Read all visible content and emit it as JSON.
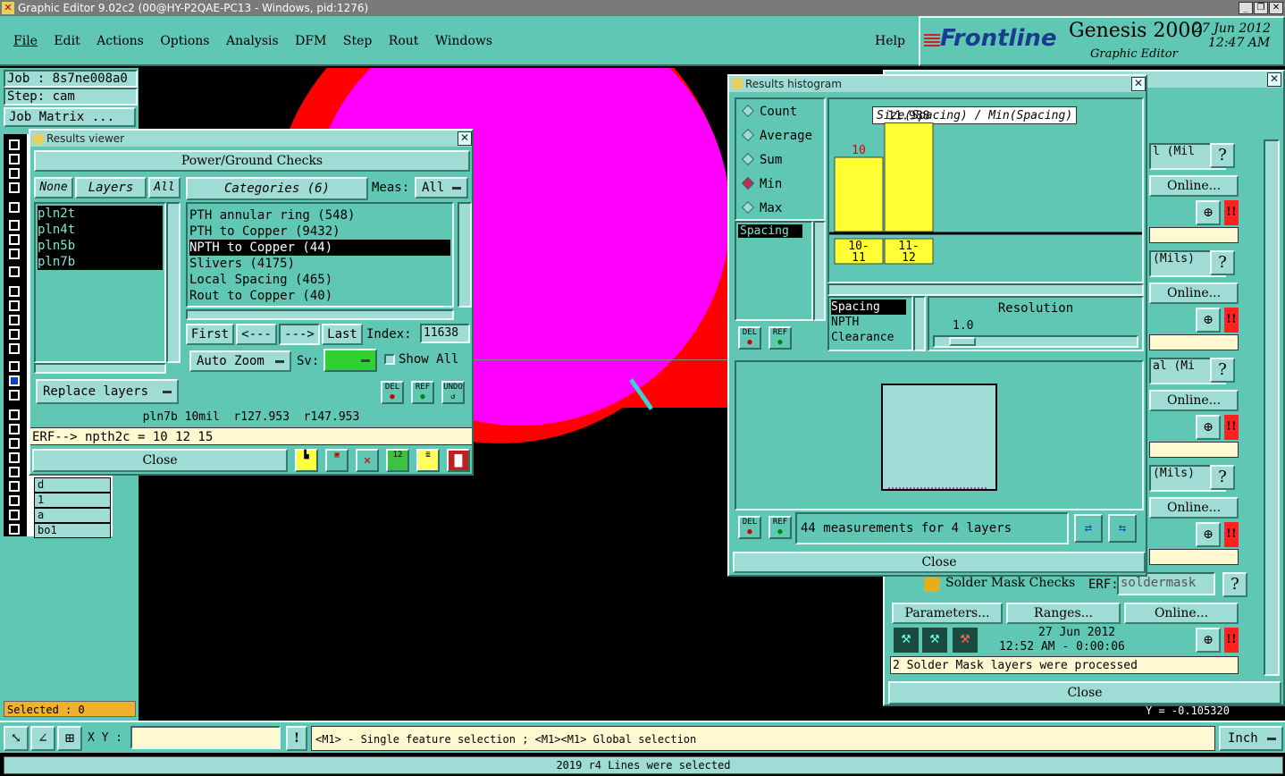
{
  "window": {
    "title": "Graphic Editor 9.02c2 (00@HY-P2QAE-PC13 - Windows, pid:1276)"
  },
  "menu": {
    "items": [
      "File",
      "Edit",
      "Actions",
      "Options",
      "Analysis",
      "DFM",
      "Step",
      "Rout",
      "Windows"
    ],
    "help": "Help"
  },
  "brand": {
    "logo": "Frontline",
    "product": "Genesis 2000",
    "date": "27 Jun 2012",
    "time": "12:47 AM",
    "subtitle": "Graphic Editor"
  },
  "left_panel": {
    "job": "Job : 8s7ne008a0",
    "step": "Step: cam",
    "job_matrix": "Job Matrix ...",
    "layers_tail": [
      "d",
      "1",
      "a",
      "bo1"
    ],
    "selected": "Selected : 0"
  },
  "results_viewer": {
    "title": "Results viewer",
    "header": "Power/Ground Checks",
    "none": "None",
    "layers": "Layers",
    "all": "All",
    "categories_label": "Categories (6)",
    "meas_label": "Meas:",
    "meas_value": "All",
    "layer_list": [
      "pln2t",
      "pln4t",
      "pln5b",
      "pln7b"
    ],
    "categories": [
      "PTH annular ring (548)",
      "PTH to Copper (9432)",
      "NPTH to Copper (44)",
      "Slivers (4175)",
      "Local Spacing (465)",
      "Rout to Copper (40)"
    ],
    "selected_category": 2,
    "first": "First",
    "prev": "<---",
    "next": "--->",
    "last": "Last",
    "index_label": "Index:",
    "index_value": "11638",
    "auto_zoom": "Auto Zoom",
    "sv_label": "Sv:",
    "show_all": "Show All",
    "replace_layers": "Replace layers",
    "info_line": "pln7b 10mil  r127.953  r147.953",
    "erf_line": "ERF--> npth2c = 10 12 15",
    "close": "Close",
    "icon_labels": {
      "del": "DEL",
      "ref": "REF",
      "undo": "UNDO"
    }
  },
  "histogram": {
    "title": "Results histogram",
    "modes": [
      "Count",
      "Average",
      "Sum",
      "Min",
      "Max"
    ],
    "selected_mode": "Min",
    "left_list": [
      "Spacing"
    ],
    "chart_title": "Size(Spacing) / Min(Spacing)",
    "bars": [
      {
        "label": "10-\n11",
        "value": 10,
        "value_label": "10"
      },
      {
        "label": "11-\n12",
        "value": 11.988,
        "value_label": "11.988"
      }
    ],
    "measures": [
      "Spacing",
      "NPTH",
      "Clearance"
    ],
    "resolution_label": "Resolution",
    "resolution_value": "1.0",
    "status": "44 measurements for 4 layers",
    "close": "Close"
  },
  "checks_panel": {
    "rows": [
      {
        "label": "l (Mil",
        "online": "Online..."
      },
      {
        "label": "(Mils)",
        "online": "Online..."
      },
      {
        "label": "al (Mi",
        "online": "Online..."
      },
      {
        "label": "(Mils)",
        "online": "Online..."
      }
    ],
    "solder": {
      "label": "Solder Mask Checks",
      "erf": "ERF:",
      "erf_value": "soldermask",
      "parameters": "Parameters...",
      "ranges": "Ranges...",
      "online": "Online...",
      "date": "27 Jun 2012",
      "time": "12:52 AM - 0:00:06",
      "message": "2 Solder Mask layers were processed"
    },
    "close": "Close",
    "y_readout": "Y = -0.105320"
  },
  "bottom": {
    "xy_label": "X Y :",
    "hint": "<M1> - Single feature selection ; <M1><M1> Global selection",
    "units": "Inch",
    "status": "2019 r4 Lines were selected"
  },
  "colors": {
    "teal": "#5fc7b3",
    "light": "#9fdcd6",
    "magenta": "#ff00ff",
    "red": "#ff0000",
    "yellow": "#ffff33"
  }
}
